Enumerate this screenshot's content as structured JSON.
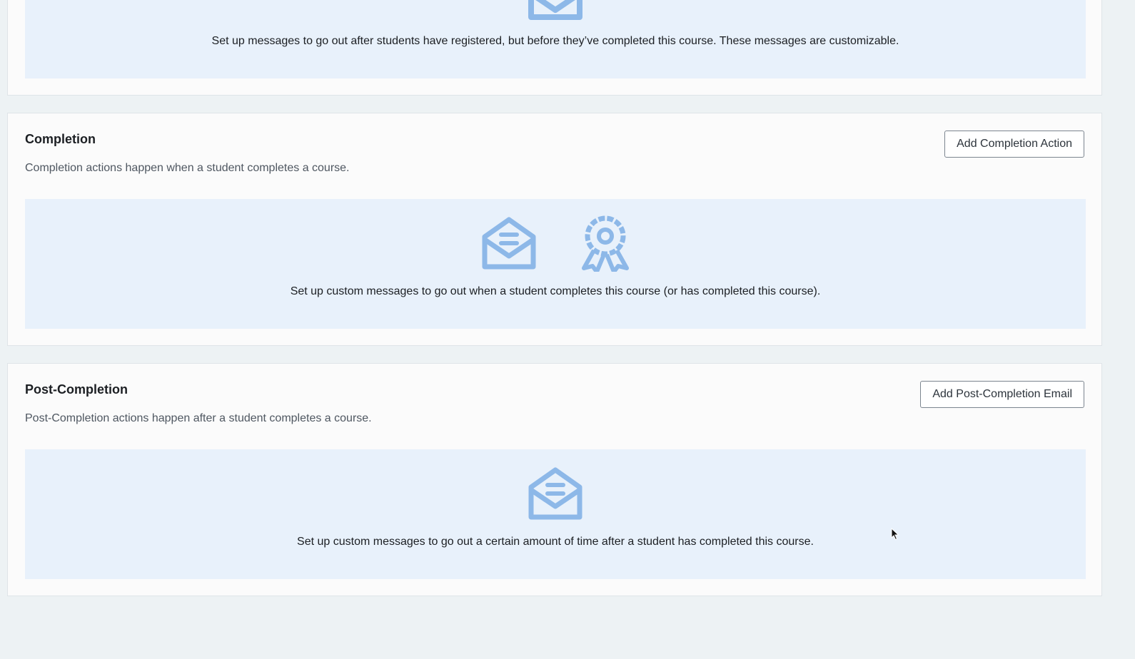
{
  "colors": {
    "page_background": "#edf2f4",
    "card_background": "#fbfbfb",
    "panel_background": "#e8f1fb",
    "icon_color": "#8db8e8"
  },
  "top_section": {
    "panel_text": "Set up messages to go out after students have registered, but before they’ve completed this course. These messages are customizable.",
    "icon": "envelope-open-icon"
  },
  "completion": {
    "title": "Completion",
    "description": "Completion actions happen when a student completes a course.",
    "button_label": "Add Completion Action",
    "panel_text": "Set up custom messages to go out when a student completes this course (or has completed this course).",
    "icons": [
      "envelope-open-icon",
      "award-ribbon-icon"
    ]
  },
  "post_completion": {
    "title": "Post-Completion",
    "description": "Post-Completion actions happen after a student completes a course.",
    "button_label": "Add Post-Completion Email",
    "panel_text": "Set up custom messages to go out a certain amount of time after a student has completed this course.",
    "icon": "envelope-open-icon"
  }
}
